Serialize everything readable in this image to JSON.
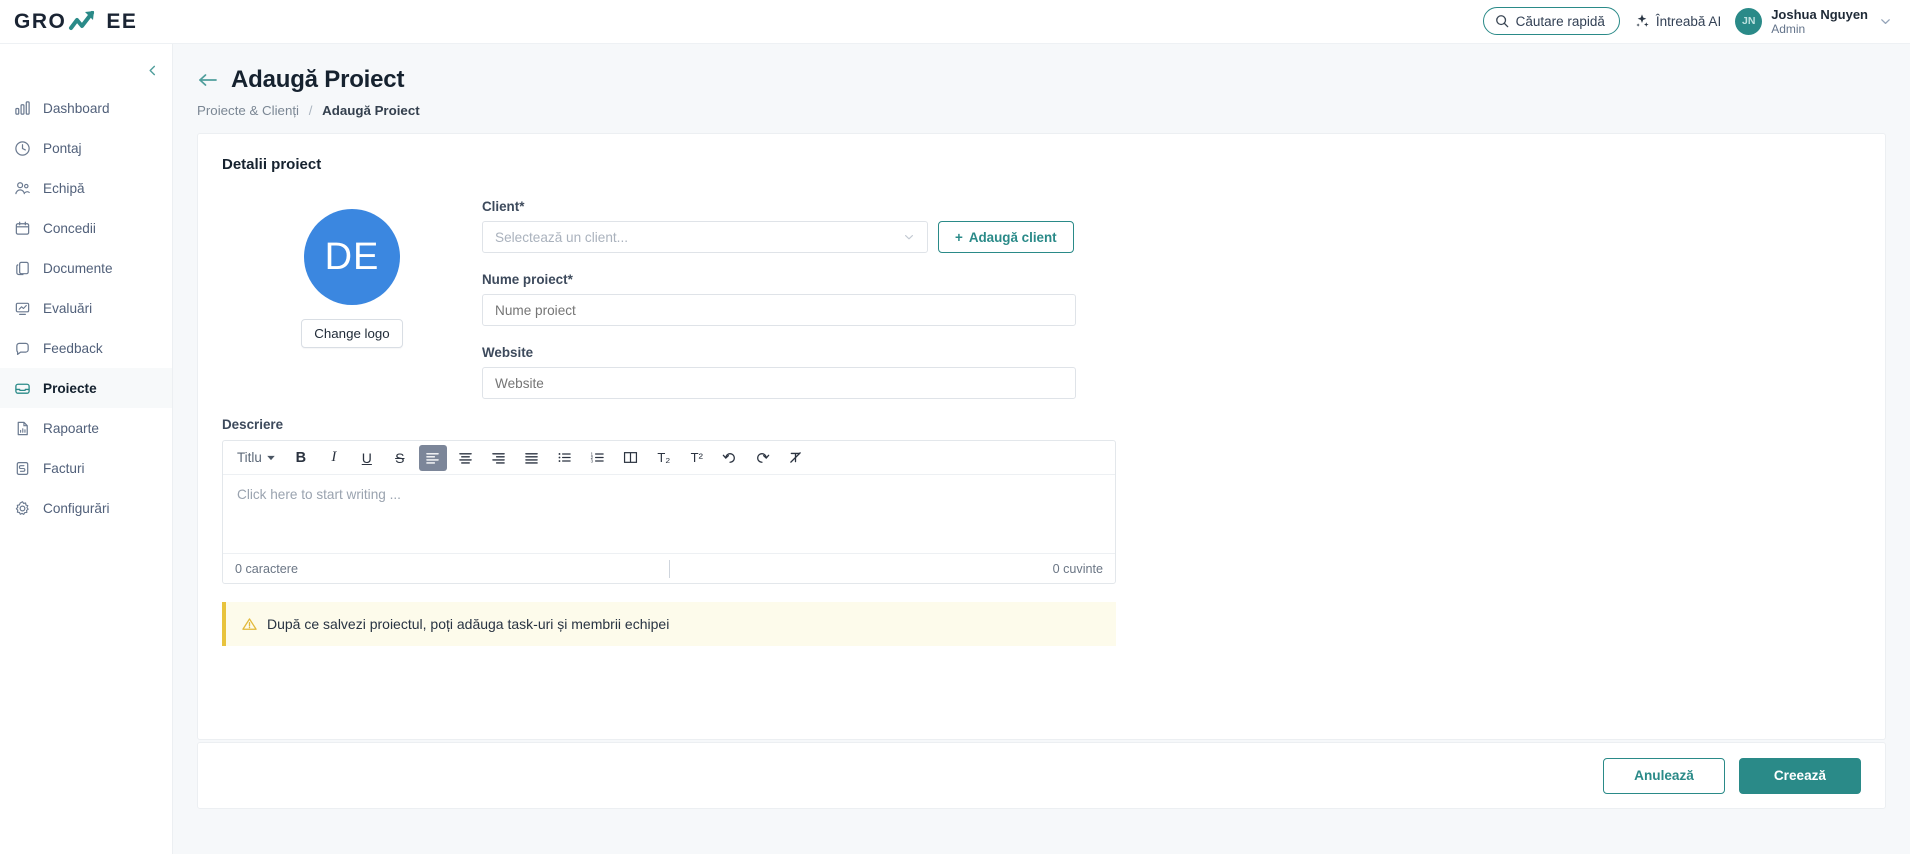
{
  "brand": {
    "name_part1": "GRO",
    "name_part2": "EE",
    "accent_color": "#2a8a88"
  },
  "topbar": {
    "search_label": "Căutare rapidă",
    "ask_ai_label": "Întreabă AI",
    "user": {
      "initials": "JN",
      "name": "Joshua Nguyen",
      "role": "Admin"
    }
  },
  "sidebar": {
    "items": [
      {
        "label": "Dashboard",
        "icon": "bar-chart-icon",
        "active": false
      },
      {
        "label": "Pontaj",
        "icon": "clock-icon",
        "active": false
      },
      {
        "label": "Echipă",
        "icon": "users-icon",
        "active": false
      },
      {
        "label": "Concedii",
        "icon": "calendar-icon",
        "active": false
      },
      {
        "label": "Documente",
        "icon": "documents-icon",
        "active": false
      },
      {
        "label": "Evaluări",
        "icon": "presentation-chart-icon",
        "active": false
      },
      {
        "label": "Feedback",
        "icon": "chat-bubble-icon",
        "active": false
      },
      {
        "label": "Proiecte",
        "icon": "inbox-icon",
        "active": true
      },
      {
        "label": "Rapoarte",
        "icon": "file-chart-icon",
        "active": false
      },
      {
        "label": "Facturi",
        "icon": "invoice-icon",
        "active": false
      },
      {
        "label": "Configurări",
        "icon": "gear-icon",
        "active": false
      }
    ]
  },
  "header": {
    "title": "Adaugă Proiect",
    "breadcrumb_parent": "Proiecte & Clienți",
    "breadcrumb_sep": "/",
    "breadcrumb_current": "Adaugă Proiect"
  },
  "form": {
    "section_title": "Detalii proiect",
    "logo": {
      "initials": "DE",
      "color": "#3b87e0",
      "change_button": "Change logo"
    },
    "client": {
      "label": "Client*",
      "placeholder": "Selectează un client...",
      "value": ""
    },
    "add_client_button": "Adaugă client",
    "add_client_plus": "+",
    "project_name": {
      "label": "Nume proiect*",
      "placeholder": "Nume proiect",
      "value": ""
    },
    "website": {
      "label": "Website",
      "placeholder": "Website",
      "value": ""
    },
    "description": {
      "label": "Descriere",
      "placeholder": "Click here to start writing ...",
      "value": "",
      "char_count": "0 caractere",
      "word_count": "0 cuvinte"
    },
    "toolbar": {
      "heading_label": "Titlu",
      "buttons": [
        {
          "name": "bold",
          "glyph": "B"
        },
        {
          "name": "italic",
          "glyph": "I"
        },
        {
          "name": "underline",
          "glyph": "U"
        },
        {
          "name": "strikethrough",
          "glyph": "S"
        },
        {
          "name": "align-left",
          "glyph": "≡",
          "active": true
        },
        {
          "name": "align-center",
          "glyph": "≡"
        },
        {
          "name": "align-right",
          "glyph": "≡"
        },
        {
          "name": "align-justify",
          "glyph": "≡"
        },
        {
          "name": "bullet-list",
          "glyph": "•"
        },
        {
          "name": "numbered-list",
          "glyph": "1."
        },
        {
          "name": "columns",
          "glyph": "▥"
        },
        {
          "name": "subscript",
          "glyph": "T₂"
        },
        {
          "name": "superscript",
          "glyph": "T²"
        },
        {
          "name": "undo",
          "glyph": "↺"
        },
        {
          "name": "redo",
          "glyph": "↻"
        },
        {
          "name": "clear-format",
          "glyph": "T̷"
        }
      ]
    }
  },
  "notice": {
    "text": "După ce salvezi proiectul, poți adăuga task-uri și membrii echipei",
    "accent_color": "#e8c33d"
  },
  "footer": {
    "cancel_label": "Anulează",
    "submit_label": "Creează"
  }
}
